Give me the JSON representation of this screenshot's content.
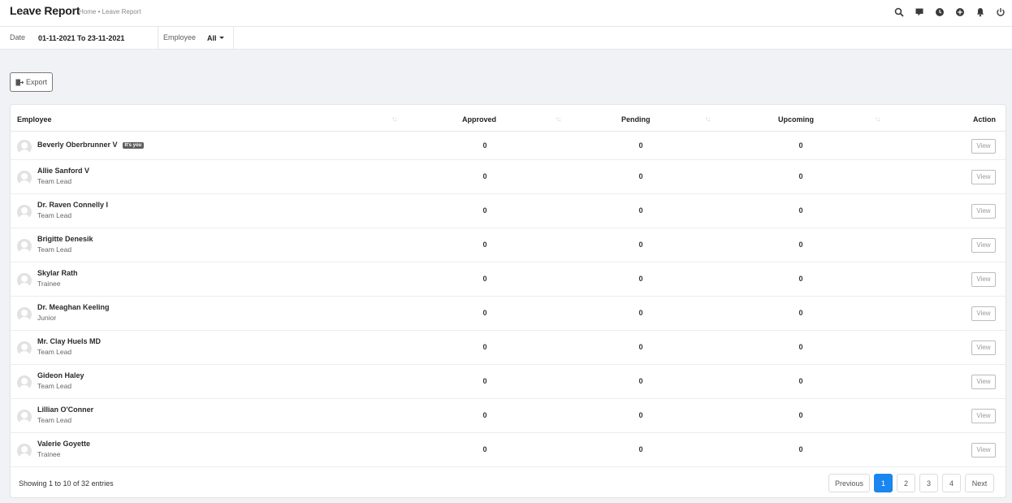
{
  "header": {
    "title": "Leave Report",
    "breadcrumb": "Home • Leave Report"
  },
  "top_icons": [
    "search-icon",
    "chat-icon",
    "clock-icon",
    "plus-circle-icon",
    "bell-icon",
    "power-icon"
  ],
  "filters": {
    "date_label": "Date",
    "date_value": "01-11-2021 To 23-11-2021",
    "employee_label": "Employee",
    "employee_value": "All"
  },
  "export_label": "Export",
  "table": {
    "columns": [
      "Employee",
      "Approved",
      "Pending",
      "Upcoming",
      "Action"
    ],
    "you_badge": "It's you",
    "view_label": "View",
    "rows": [
      {
        "name": "Beverly Oberbrunner V",
        "role": "",
        "you": true,
        "approved": "0",
        "pending": "0",
        "upcoming": "0"
      },
      {
        "name": "Allie Sanford V",
        "role": "Team Lead",
        "you": false,
        "approved": "0",
        "pending": "0",
        "upcoming": "0"
      },
      {
        "name": "Dr. Raven Connelly I",
        "role": "Team Lead",
        "you": false,
        "approved": "0",
        "pending": "0",
        "upcoming": "0"
      },
      {
        "name": "Brigitte Denesik",
        "role": "Team Lead",
        "you": false,
        "approved": "0",
        "pending": "0",
        "upcoming": "0"
      },
      {
        "name": "Skylar Rath",
        "role": "Trainee",
        "you": false,
        "approved": "0",
        "pending": "0",
        "upcoming": "0"
      },
      {
        "name": "Dr. Meaghan Keeling",
        "role": "Junior",
        "you": false,
        "approved": "0",
        "pending": "0",
        "upcoming": "0"
      },
      {
        "name": "Mr. Clay Huels MD",
        "role": "Team Lead",
        "you": false,
        "approved": "0",
        "pending": "0",
        "upcoming": "0"
      },
      {
        "name": "Gideon Haley",
        "role": "Team Lead",
        "you": false,
        "approved": "0",
        "pending": "0",
        "upcoming": "0"
      },
      {
        "name": "Lillian O'Conner",
        "role": "Team Lead",
        "you": false,
        "approved": "0",
        "pending": "0",
        "upcoming": "0"
      },
      {
        "name": "Valerie Goyette",
        "role": "Trainee",
        "you": false,
        "approved": "0",
        "pending": "0",
        "upcoming": "0"
      }
    ]
  },
  "footer": {
    "info": "Showing 1 to 10 of 32 entries",
    "prev_label": "Previous",
    "next_label": "Next",
    "pages": [
      "1",
      "2",
      "3",
      "4"
    ],
    "active_page": "1"
  },
  "colors": {
    "accent": "#1a86f0",
    "background": "#f1f2f6",
    "badge": "#5f5f5f"
  }
}
